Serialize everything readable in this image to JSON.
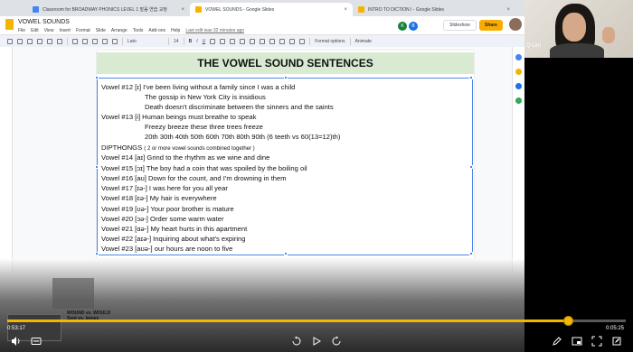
{
  "tabs": [
    {
      "label": "Classroom for BROADWAY PHONICS LEVEL 1 발음 연습 교정",
      "close": "×"
    },
    {
      "label": "VOWEL SOUNDS - Google Slides",
      "close": "×"
    },
    {
      "label": "INTRO TO DICTION I - Google Slides",
      "close": "×"
    }
  ],
  "app": {
    "doc_title": "VOWEL SOUNDS",
    "menus": [
      "File",
      "Edit",
      "View",
      "Insert",
      "Format",
      "Slide",
      "Arrange",
      "Tools",
      "Add-ons",
      "Help"
    ],
    "last_edit": "Last edit was 32 minutes ago",
    "avatar_1": "K",
    "avatar_2": "B",
    "slideshow_label": "Slideshow",
    "share_label": "Share"
  },
  "toolbar": {
    "font": "Lato",
    "font_size": "14",
    "format_options": "Format options",
    "animate": "Animate"
  },
  "slide": {
    "title": "THE VOWEL SOUND SENTENCES",
    "lines": [
      {
        "text": "Vowel #12 [ɪ] I've been living without a family since I was a child",
        "indent": false
      },
      {
        "text": "The gossip in New York City is insidious",
        "indent": true
      },
      {
        "text": "Death doesn't discriminate between the sinners and the saints",
        "indent": true
      },
      {
        "text": "Vowel #13 [i] Human beings must breathe to speak",
        "indent": false
      },
      {
        "text": "Freezy breeze these three trees freeze",
        "indent": true
      },
      {
        "text": "20th 30th 40th 50th 60th 70th 80th 90th  (6 teeth vs 60(13=12)th)",
        "indent": true
      },
      {
        "text": "DIPTHONGS",
        "small": "( 2 or more vowel sounds combined together )",
        "indent": false
      },
      {
        "text": "Vowel #14 [aɪ] Grind to the rhythm as we wine and dine",
        "indent": false
      },
      {
        "text": "Vowel #15 [ɔɪ] The boy had a coin that was spoiled by the boiling oil",
        "indent": false
      },
      {
        "text": "Vowel #16 [aʊ] Down for the count, and I'm drowning in them",
        "indent": false
      },
      {
        "text": "Vowel #17 [ɪə-] I was here for you all year",
        "indent": false
      },
      {
        "text": "Vowel #18 [ɛə-] My hair is everywhere",
        "indent": false
      },
      {
        "text": "Vowel #19 [ʊə-] Your poor brother is mature",
        "indent": false
      },
      {
        "text": "Vowel #20 [ɔə-] Order some warm water",
        "indent": false
      },
      {
        "text": "Vowel #21 [ɑə-] My heart hurts in this apartment",
        "indent": false
      },
      {
        "text": "Vowel #22 [aɪə-] Inquiring about what's expiring",
        "indent": false
      },
      {
        "text": "Vowel #23 [aʊə-] our hours are noon to five",
        "indent": false
      }
    ]
  },
  "notes": {
    "line_1": "WOUND vs. WOULD",
    "line_2": "Sent vs. bones"
  },
  "player": {
    "elapsed": "0:53:17",
    "total": "0:05:25",
    "progress": 0.907,
    "accent": "#f2b705"
  },
  "webcam": {
    "name": "Q Lim"
  },
  "icons": {
    "volume": "volume-icon",
    "captions": "captions-icon",
    "rewind": "rewind-10-icon",
    "play": "play-icon",
    "forward": "forward-10-icon",
    "pen": "pen-icon",
    "pip": "picture-in-picture-icon",
    "edit": "edit-icon",
    "fullscreen": "fullscreen-icon"
  }
}
